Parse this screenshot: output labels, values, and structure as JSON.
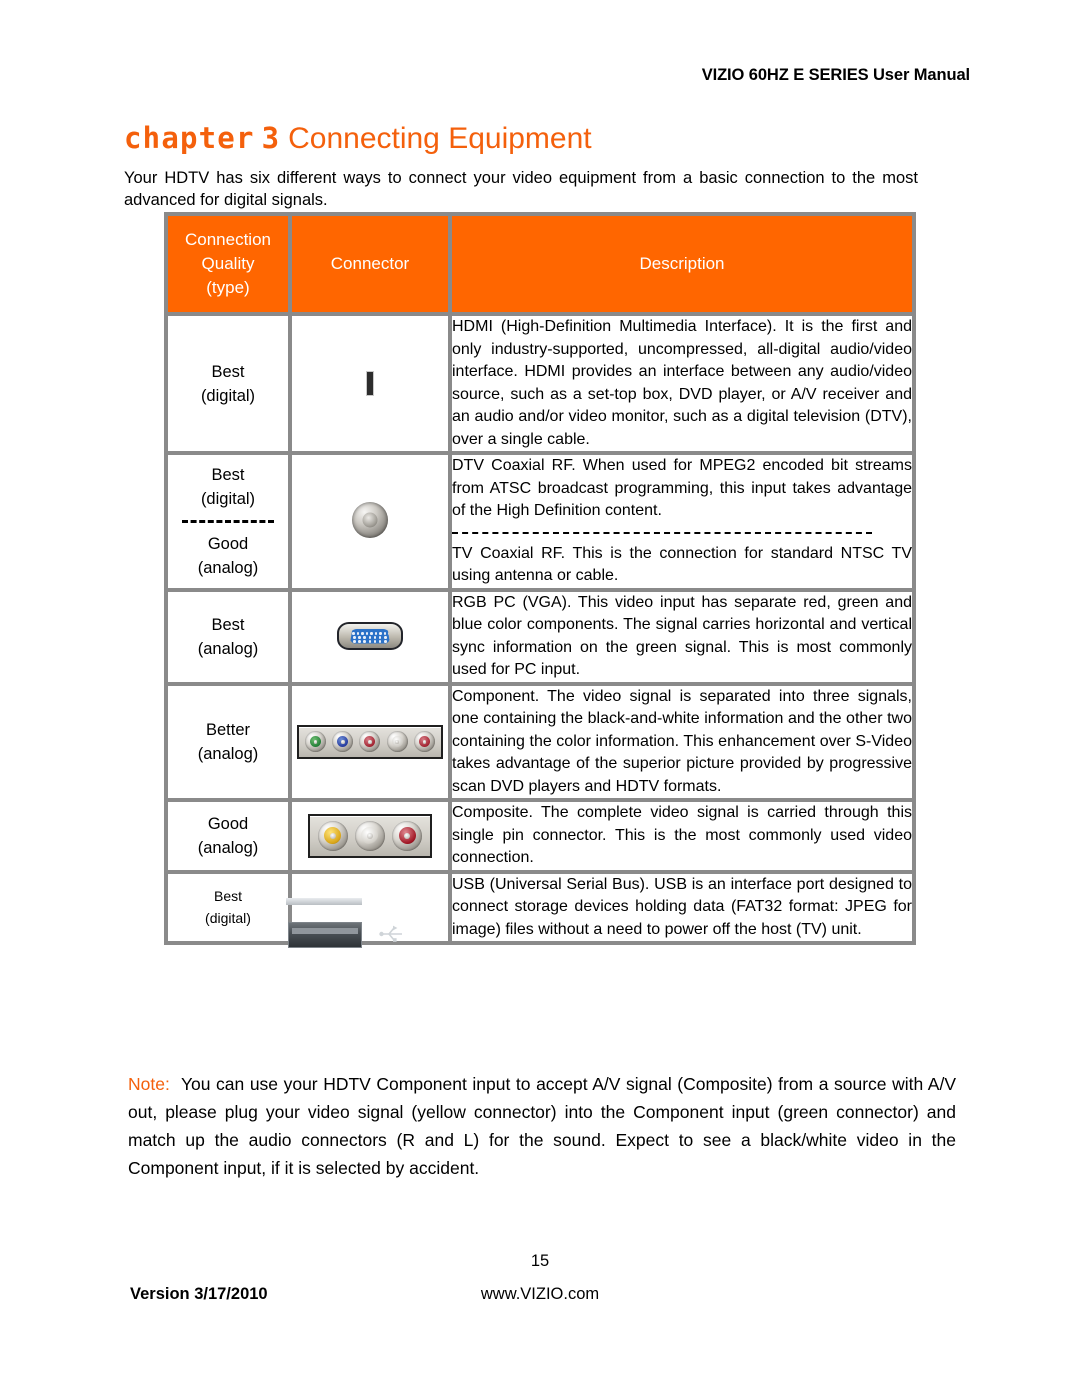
{
  "header": {
    "running_head": "VIZIO 60HZ E SERIES User Manual"
  },
  "chapter": {
    "word": "Chapter",
    "number": "3",
    "title": "Connecting Equipment",
    "accent_color": "#F4600C"
  },
  "intro": {
    "text": "Your HDTV has six different ways to connect your video equipment from a basic connection to the most advanced for digital signals."
  },
  "table": {
    "header_background": "#FF6600",
    "border_color": "#8A8A8A",
    "columns": [
      {
        "label": "Connection Quality (type)",
        "lines": [
          "Connection",
          "Quality",
          "(type)"
        ]
      },
      {
        "label": "Connector",
        "lines": [
          "Connector"
        ]
      },
      {
        "label": "Description",
        "lines": [
          "Description"
        ]
      }
    ],
    "rows": [
      {
        "quality_lines": [
          "Best",
          "(digital)"
        ],
        "quality_small": false,
        "quality_has_dash": false,
        "connector_icon": "hdmi-connector-icon",
        "description_blocks": [
          "HDMI (High-Definition Multimedia Interface). It is the first and only industry-supported, uncompressed, all-digital audio/video interface. HDMI provides an interface between any audio/video source, such as a set-top box, DVD player, or A/V receiver and an audio and/or video monitor, such as a digital television (DTV), over a single cable."
        ],
        "description_has_dash": false
      },
      {
        "quality_lines": [
          "Best",
          "(digital)"
        ],
        "quality_lines_2": [
          "Good",
          "(analog)"
        ],
        "quality_small": false,
        "quality_has_dash": true,
        "connector_icon": "coaxial-rf-connector-icon",
        "description_blocks": [
          "DTV Coaxial RF.  When used for MPEG2 encoded bit streams from ATSC broadcast programming, this input takes advantage of the High Definition content.",
          "TV Coaxial RF. This is the connection for standard NTSC TV using antenna or cable."
        ],
        "description_has_dash": true
      },
      {
        "quality_lines": [
          "Best",
          "(analog)"
        ],
        "quality_small": false,
        "quality_has_dash": false,
        "connector_icon": "vga-connector-icon",
        "description_blocks": [
          "RGB PC (VGA). This video input has separate red, green and blue color components.   The signal carries horizontal and vertical sync information on the green signal.   This is most commonly used for PC input."
        ],
        "description_has_dash": false
      },
      {
        "quality_lines": [
          "Better",
          "(analog)"
        ],
        "quality_small": false,
        "quality_has_dash": false,
        "connector_icon": "component-rca-connector-icon",
        "description_blocks": [
          "Component. The video signal is separated into three signals, one containing the black-and-white information and the other two containing the color information. This enhancement over S-Video takes advantage of the superior picture provided by progressive scan DVD players and HDTV formats."
        ],
        "description_has_dash": false
      },
      {
        "quality_lines": [
          "Good",
          "(analog)"
        ],
        "quality_small": false,
        "quality_has_dash": false,
        "connector_icon": "composite-rca-connector-icon",
        "description_blocks": [
          "Composite. The complete video signal is carried through this single pin connector. This is the most commonly used video connection."
        ],
        "description_has_dash": false
      },
      {
        "quality_lines": [
          "Best",
          "(digital)"
        ],
        "quality_small": true,
        "quality_has_dash": false,
        "connector_icon": "usb-connector-icon",
        "description_blocks": [
          "USB (Universal Serial Bus). USB is an interface port designed to connect storage devices holding data (FAT32 format: JPEG for image) files without a need to power off the host (TV) unit."
        ],
        "description_has_dash": false
      }
    ]
  },
  "note": {
    "label": "Note:",
    "text": "You can use your HDTV Component input to accept A/V signal (Composite) from a source with A/V out, please plug your video signal (yellow connector) into the Component input (green connector) and match up the audio connectors (R and L) for the sound. Expect to see a black/white video in the Component input, if it is selected by accident."
  },
  "footer": {
    "page_number": "15",
    "version": "Version 3/17/2010",
    "website": "www.VIZIO.com"
  }
}
